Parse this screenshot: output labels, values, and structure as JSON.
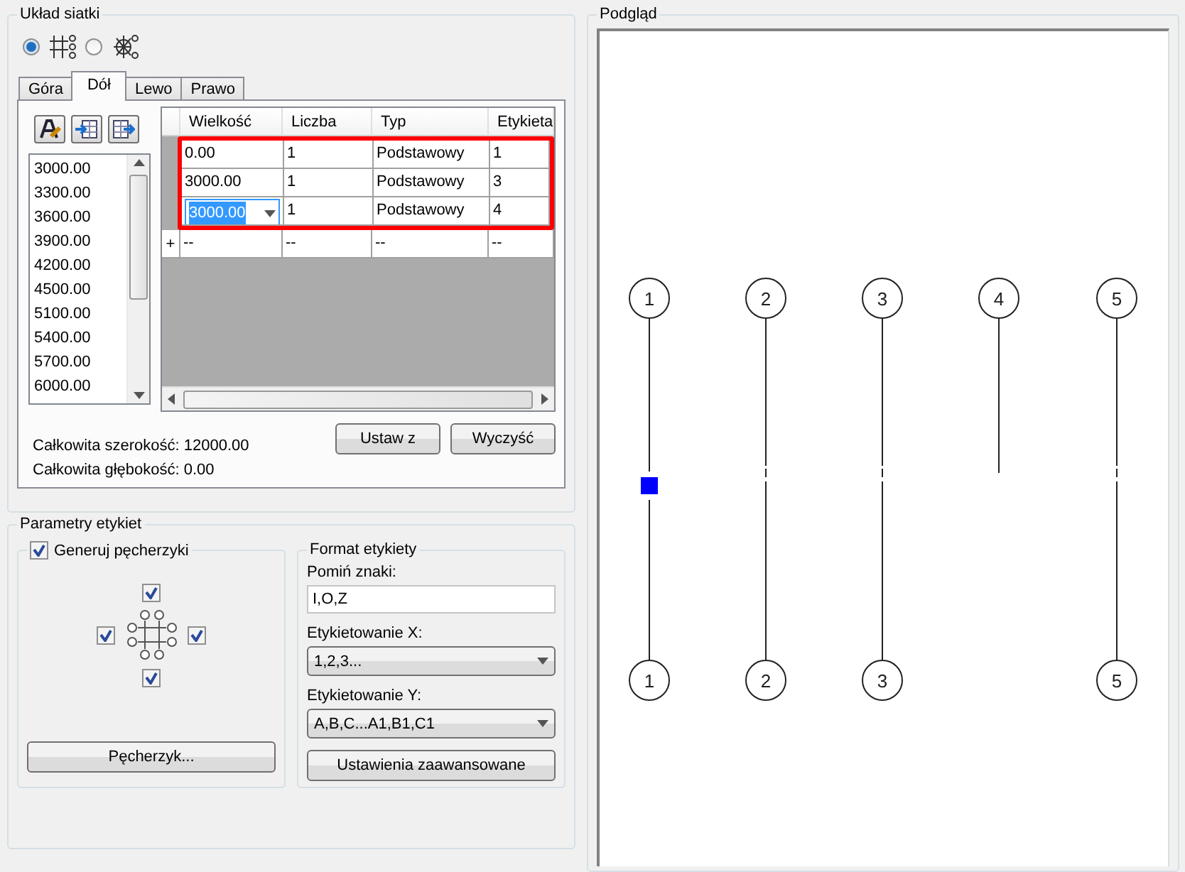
{
  "grid_layout": {
    "title": "Układ siatki",
    "layout_options": [
      {
        "kind": "rectangular",
        "selected": true
      },
      {
        "kind": "radial",
        "selected": false
      }
    ],
    "tabs": [
      {
        "label": "Góra",
        "selected": false
      },
      {
        "label": "Dół",
        "selected": true
      },
      {
        "label": "Lewo",
        "selected": false
      },
      {
        "label": "Prawo",
        "selected": false
      }
    ],
    "spacing_list": [
      "3000.00",
      "3300.00",
      "3600.00",
      "3900.00",
      "4200.00",
      "4500.00",
      "5100.00",
      "5400.00",
      "5700.00",
      "6000.00"
    ],
    "table": {
      "columns": [
        "Wielkość",
        "Liczba",
        "Typ",
        "Etykieta"
      ],
      "highlighted": true,
      "rows": [
        {
          "kind": "normal",
          "cells": [
            "0.00",
            "1",
            "Podstawowy",
            "1"
          ]
        },
        {
          "kind": "normal",
          "cells": [
            "3000.00",
            "1",
            "Podstawowy",
            "3"
          ]
        },
        {
          "kind": "editing",
          "cells": [
            "3000.00",
            "1",
            "Podstawowy",
            "4"
          ]
        }
      ],
      "new_row": {
        "marker": "+",
        "cells": [
          "--",
          "--",
          "--",
          "--"
        ]
      }
    },
    "total_width": "Całkowita szerokość: 12000.00",
    "total_depth": "Całkowita głębokość: 0.00",
    "buttons": [
      "Ustaw z",
      "Wyczyść"
    ]
  },
  "label_params": {
    "title": "Parametry etykiet",
    "generate_bubbles": {
      "label": "Generuj pęcherzyki",
      "checked": true,
      "top": true,
      "left": true,
      "right": true,
      "bottom": true,
      "button": "Pęcherzyk..."
    },
    "label_format": {
      "title": "Format etykiety",
      "skip_label": "Pomiń znaki:",
      "skip_value": "I,O,Z",
      "x_label": "Etykietowanie X:",
      "x_value": "1,2,3...",
      "y_label": "Etykietowanie Y:",
      "y_value": "A,B,C...A1,B1,C1",
      "advanced_button": "Ustawienia zaawansowane"
    }
  },
  "preview": {
    "title": "Podgląd",
    "axes": [
      {
        "top_label": "1",
        "bottom_label": "1",
        "selected": true
      },
      {
        "top_label": "2",
        "bottom_label": "2",
        "selected": false
      },
      {
        "top_label": "3",
        "bottom_label": "3",
        "selected": false
      },
      {
        "top_label": "4",
        "selected": false
      },
      {
        "top_label": "5",
        "bottom_label": "5",
        "selected": false
      }
    ]
  }
}
